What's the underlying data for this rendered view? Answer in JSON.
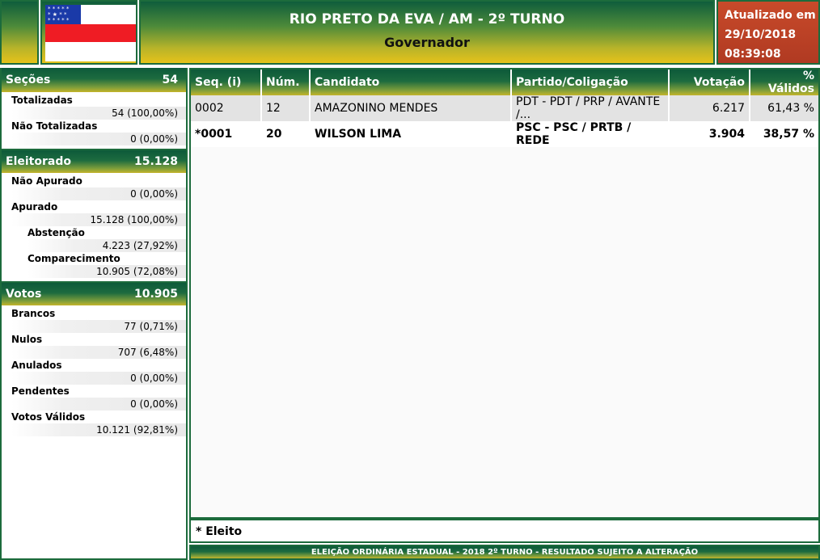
{
  "header": {
    "title": "RIO PRETO DA EVA / AM - 2º TURNO",
    "subtitle": "Governador",
    "updated_label": "Atualizado em",
    "updated_date": "29/10/2018",
    "updated_time": "08:39:08"
  },
  "flag": {
    "icon": "amazonas-flag-icon",
    "colors": {
      "blue": "#1a3aa8",
      "red": "#ef1c24",
      "white": "#ffffff"
    }
  },
  "secoes": {
    "label": "Seções",
    "value": "54",
    "totalizadas_label": "Totalizadas",
    "totalizadas_value": "54 (100,00%)",
    "nao_totalizadas_label": "Não Totalizadas",
    "nao_totalizadas_value": "0 (0,00%)"
  },
  "eleitorado": {
    "label": "Eleitorado",
    "value": "15.128",
    "nao_apurado_label": "Não Apurado",
    "nao_apurado_value": "0 (0,00%)",
    "apurado_label": "Apurado",
    "apurado_value": "15.128 (100,00%)",
    "abstencao_label": "Abstenção",
    "abstencao_value": "4.223 (27,92%)",
    "comparecimento_label": "Comparecimento",
    "comparecimento_value": "10.905 (72,08%)"
  },
  "votos": {
    "label": "Votos",
    "value": "10.905",
    "brancos_label": "Brancos",
    "brancos_value": "77 (0,71%)",
    "nulos_label": "Nulos",
    "nulos_value": "707 (6,48%)",
    "anulados_label": "Anulados",
    "anulados_value": "0 (0,00%)",
    "pendentes_label": "Pendentes",
    "pendentes_value": "0 (0,00%)",
    "validos_label": "Votos Válidos",
    "validos_value": "10.121 (92,81%)"
  },
  "table": {
    "headers": [
      "Seq.  (i)",
      "Núm.",
      "Candidato",
      "Partido/Coligação",
      "Votação",
      "% Válidos"
    ],
    "rows": [
      [
        "0002",
        "12",
        "AMAZONINO MENDES",
        "PDT - PDT / PRP / AVANTE /...",
        "6.217",
        "61,43 %"
      ],
      [
        "*0001",
        "20",
        "WILSON LIMA",
        "PSC - PSC / PRTB / REDE",
        "3.904",
        "38,57 %"
      ]
    ]
  },
  "footer": {
    "note": "* Eleito",
    "bar": "ELEIÇÃO ORDINÁRIA ESTADUAL - 2018 2º TURNO - RESULTADO SUJEITO A ALTERAÇÃO"
  }
}
